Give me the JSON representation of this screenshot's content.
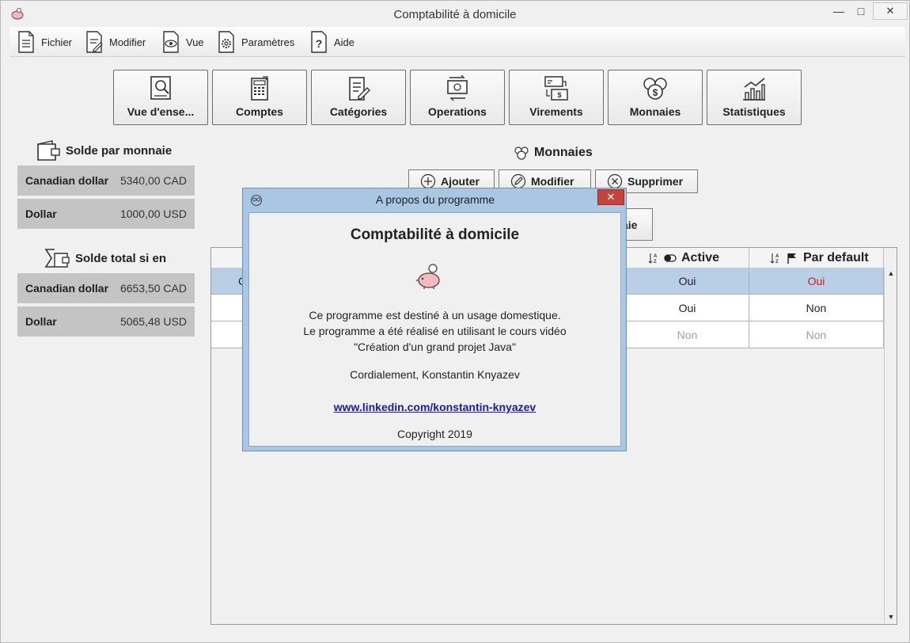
{
  "window": {
    "title": "Comptabilité à domicile"
  },
  "menu": {
    "items": [
      {
        "label": "Fichier",
        "icon": "file-icon"
      },
      {
        "label": "Modifier",
        "icon": "edit-document-icon"
      },
      {
        "label": "Vue",
        "icon": "eye-document-icon"
      },
      {
        "label": "Paramètres",
        "icon": "gear-document-icon"
      },
      {
        "label": "Aide",
        "icon": "help-document-icon"
      }
    ]
  },
  "toolbar": {
    "buttons": [
      {
        "label": "Vue d'ense...",
        "icon": "overview-icon"
      },
      {
        "label": "Comptes",
        "icon": "calculator-icon"
      },
      {
        "label": "Catégories",
        "icon": "categories-icon"
      },
      {
        "label": "Operations",
        "icon": "exchange-icon"
      },
      {
        "label": "Virements",
        "icon": "transfer-icon"
      },
      {
        "label": "Monnaies",
        "icon": "coins-icon"
      },
      {
        "label": "Statistiques",
        "icon": "chart-icon"
      }
    ]
  },
  "left_panel": {
    "balance_title": "Solde par monnaie",
    "balances": [
      {
        "name": "Canadian dollar",
        "value": "5340,00 CAD"
      },
      {
        "name": "Dollar",
        "value": "1000,00 USD"
      }
    ],
    "total_title": "Solde total si en",
    "totals": [
      {
        "name": "Canadian dollar",
        "value": "6653,50 CAD"
      },
      {
        "name": "Dollar",
        "value": "5065,48 USD"
      }
    ]
  },
  "right_panel": {
    "title": "Monnaies",
    "buttons": {
      "add": "Ajouter",
      "edit": "Modifier",
      "delete": "Supprimer"
    },
    "hidden_button_partial": "aie",
    "columns": {
      "active": "Active",
      "default": "Par default"
    },
    "first_col_partial": "C",
    "rows": [
      {
        "active": "Oui",
        "default": "Oui"
      },
      {
        "active": "Oui",
        "default": "Non"
      },
      {
        "active": "Non",
        "default": "Non"
      }
    ]
  },
  "dialog": {
    "title": "A propos du programme",
    "heading": "Comptabilité à domicile",
    "line1": "Ce programme est destiné à un usage domestique.",
    "line2": "Le programme a été réalisé en utilisant le cours vidéo",
    "line3": "\"Création d'un grand projet Java\"",
    "regards": "Cordialement, Konstantin Knyazev",
    "link": "www.linkedin.com/konstantin-knyazev",
    "copyright": "Copyright 2019",
    "close_label": "✕"
  }
}
